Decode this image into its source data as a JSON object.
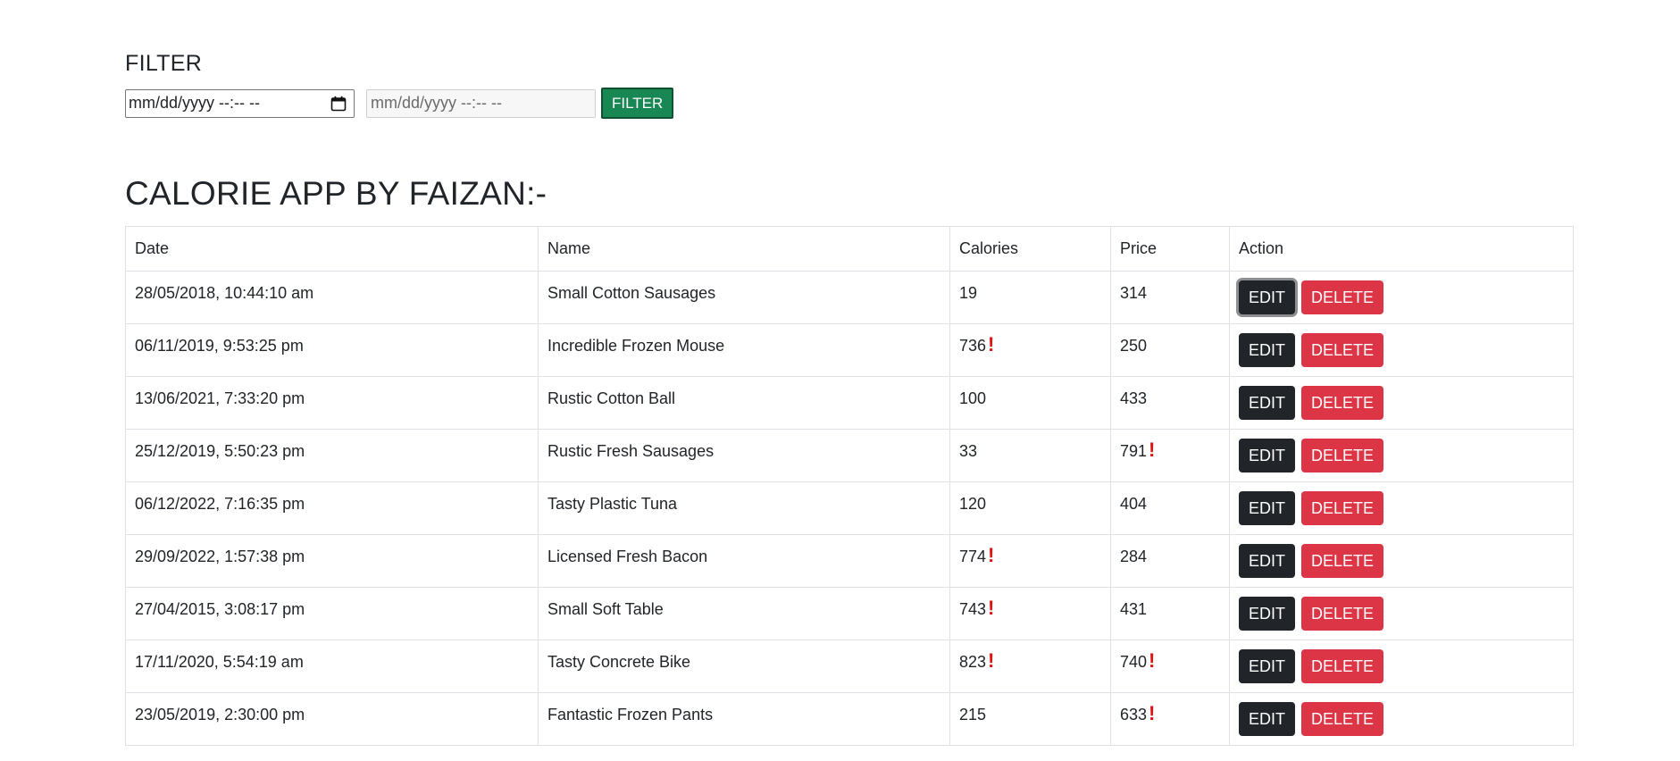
{
  "filter": {
    "title": "FILTER",
    "start_placeholder": "mm/dd/yyyy --:-- --",
    "end_placeholder": "mm/dd/yyyy --:-- --",
    "button_label": "FILTER"
  },
  "app_title": "CALORIE APP BY FAIZAN:-",
  "table": {
    "headers": [
      "Date",
      "Name",
      "Calories",
      "Price",
      "Action"
    ],
    "edit_label": "EDIT",
    "delete_label": "DELETE",
    "rows": [
      {
        "date": "28/05/2018, 10:44:10 am",
        "name": "Small Cotton Sausages",
        "calories": "19",
        "calories_warn": false,
        "price": "314",
        "price_warn": false
      },
      {
        "date": "06/11/2019, 9:53:25 pm",
        "name": "Incredible Frozen Mouse",
        "calories": "736",
        "calories_warn": true,
        "price": "250",
        "price_warn": false
      },
      {
        "date": "13/06/2021, 7:33:20 pm",
        "name": "Rustic Cotton Ball",
        "calories": "100",
        "calories_warn": false,
        "price": "433",
        "price_warn": false
      },
      {
        "date": "25/12/2019, 5:50:23 pm",
        "name": "Rustic Fresh Sausages",
        "calories": "33",
        "calories_warn": false,
        "price": "791",
        "price_warn": true
      },
      {
        "date": "06/12/2022, 7:16:35 pm",
        "name": "Tasty Plastic Tuna",
        "calories": "120",
        "calories_warn": false,
        "price": "404",
        "price_warn": false
      },
      {
        "date": "29/09/2022, 1:57:38 pm",
        "name": "Licensed Fresh Bacon",
        "calories": "774",
        "calories_warn": true,
        "price": "284",
        "price_warn": false
      },
      {
        "date": "27/04/2015, 3:08:17 pm",
        "name": "Small Soft Table",
        "calories": "743",
        "calories_warn": true,
        "price": "431",
        "price_warn": false
      },
      {
        "date": "17/11/2020, 5:54:19 am",
        "name": "Tasty Concrete Bike",
        "calories": "823",
        "calories_warn": true,
        "price": "740",
        "price_warn": true
      },
      {
        "date": "23/05/2019, 2:30:00 pm",
        "name": "Fantastic Frozen Pants",
        "calories": "215",
        "calories_warn": false,
        "price": "633",
        "price_warn": true
      }
    ]
  },
  "warning_glyph": "!",
  "colors": {
    "filter_button": "#198754",
    "edit_button": "#212529",
    "delete_button": "#dc3545",
    "warning": "#e01212"
  }
}
